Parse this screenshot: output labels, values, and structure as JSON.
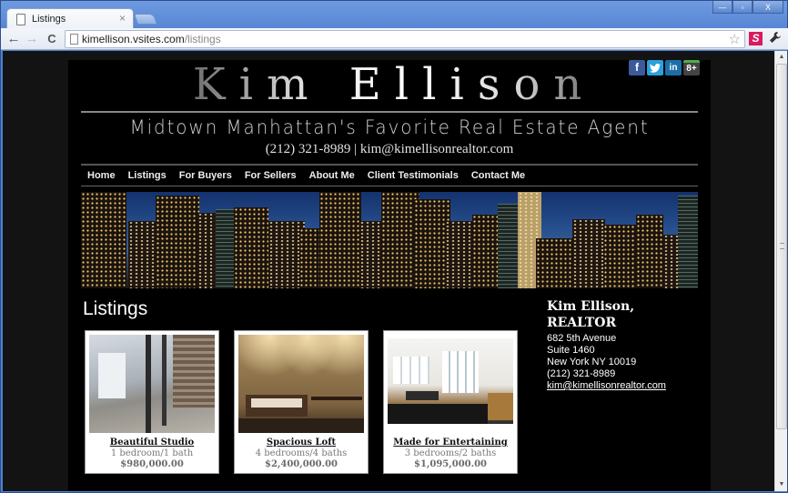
{
  "browser": {
    "tab_title": "Listings",
    "tab_close": "×",
    "url_host": "kimellison.vsites.com",
    "url_path": "/listings",
    "back": "←",
    "forward": "→",
    "reload": "C",
    "star": "☆",
    "extension_label": "S",
    "wrench": "🔧",
    "window_controls": {
      "minimize": "—",
      "maximize": "▫",
      "close": "X"
    },
    "scroll_up": "▲",
    "scroll_down": "▼"
  },
  "header": {
    "brand_name": "Kim Ellison",
    "tagline": "Midtown Manhattan's Favorite Real Estate Agent",
    "contact_line": "(212) 321-8989  |  kim@kimellisonrealtor.com",
    "social": [
      {
        "name": "facebook",
        "glyph": "f"
      },
      {
        "name": "twitter",
        "glyph": "t"
      },
      {
        "name": "linkedin",
        "glyph": "in"
      },
      {
        "name": "google-plus",
        "glyph": "8+"
      }
    ]
  },
  "nav": {
    "items": [
      "Home",
      "Listings",
      "For Buyers",
      "For Sellers",
      "About Me",
      "Client Testimonials",
      "Contact Me"
    ]
  },
  "main": {
    "heading": "Listings",
    "listings": [
      {
        "name": "Beautiful Studio",
        "rooms": "1 bedroom/1 bath",
        "price": "$980,000.00"
      },
      {
        "name": "Spacious Loft",
        "rooms": "4 bedrooms/4 baths",
        "price": "$2,400,000.00"
      },
      {
        "name": "Made for Entertaining",
        "rooms": "3 bedrooms/2 baths",
        "price": "$1,095,000.00"
      }
    ]
  },
  "sidebar": {
    "title_line1": "Kim Ellison,",
    "title_line2": "REALTOR",
    "address1": "682 5th Avenue",
    "address2": "Suite 1460",
    "address3": "New York NY 10019",
    "phone": "(212) 321-8989",
    "email": "kim@kimellisonrealtor.com"
  }
}
